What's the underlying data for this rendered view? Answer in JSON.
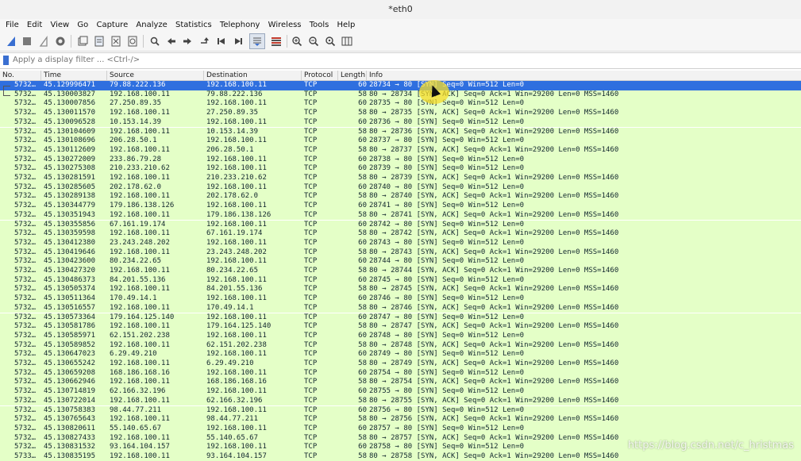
{
  "window": {
    "title": "*eth0"
  },
  "menu": [
    "File",
    "Edit",
    "View",
    "Go",
    "Capture",
    "Analyze",
    "Statistics",
    "Telephony",
    "Wireless",
    "Tools",
    "Help"
  ],
  "filter": {
    "placeholder": "Apply a display filter ... <Ctrl-/>"
  },
  "columns": {
    "no": "No.",
    "time": "Time",
    "source": "Source",
    "destination": "Destination",
    "protocol": "Protocol",
    "length": "Length",
    "info": "Info"
  },
  "packets": [
    {
      "no": "5732…",
      "time": "45.129996471",
      "src": "79.88.222.136",
      "dst": "192.168.100.11",
      "proto": "TCP",
      "len": "60",
      "info": "28734 → 80 [SYN] Seq=0 Win=512 Len=0",
      "selected": true
    },
    {
      "no": "5732…",
      "time": "45.130003827",
      "src": "192.168.100.11",
      "dst": "79.88.222.136",
      "proto": "TCP",
      "len": "58",
      "info": "80 → 28734 [SYN, ACK] Seq=0 Ack=1 Win=29200 Len=0 MSS=1460"
    },
    {
      "no": "5732…",
      "time": "45.130007856",
      "src": "27.250.89.35",
      "dst": "192.168.100.11",
      "proto": "TCP",
      "len": "60",
      "info": "28735 → 80 [SYN] Seq=0 Win=512 Len=0"
    },
    {
      "no": "5732…",
      "time": "45.130011570",
      "src": "192.168.100.11",
      "dst": "27.250.89.35",
      "proto": "TCP",
      "len": "58",
      "info": "80 → 28735 [SYN, ACK] Seq=0 Ack=1 Win=29200 Len=0 MSS=1460"
    },
    {
      "no": "5732…",
      "time": "45.130096528",
      "src": "10.153.14.39",
      "dst": "192.168.100.11",
      "proto": "TCP",
      "len": "60",
      "info": "28736 → 80 [SYN] Seq=0 Win=512 Len=0"
    },
    {
      "no": "5732…",
      "time": "45.130104609",
      "src": "192.168.100.11",
      "dst": "10.153.14.39",
      "proto": "TCP",
      "len": "58",
      "info": "80 → 28736 [SYN, ACK] Seq=0 Ack=1 Win=29200 Len=0 MSS=1460"
    },
    {
      "no": "5732…",
      "time": "45.130108696",
      "src": "206.28.50.1",
      "dst": "192.168.100.11",
      "proto": "TCP",
      "len": "60",
      "info": "28737 → 80 [SYN] Seq=0 Win=512 Len=0"
    },
    {
      "no": "5732…",
      "time": "45.130112609",
      "src": "192.168.100.11",
      "dst": "206.28.50.1",
      "proto": "TCP",
      "len": "58",
      "info": "80 → 28737 [SYN, ACK] Seq=0 Ack=1 Win=29200 Len=0 MSS=1460"
    },
    {
      "no": "5732…",
      "time": "45.130272009",
      "src": "233.86.79.28",
      "dst": "192.168.100.11",
      "proto": "TCP",
      "len": "60",
      "info": "28738 → 80 [SYN] Seq=0 Win=512 Len=0"
    },
    {
      "no": "5732…",
      "time": "45.130275308",
      "src": "210.233.210.62",
      "dst": "192.168.100.11",
      "proto": "TCP",
      "len": "60",
      "info": "28739 → 80 [SYN] Seq=0 Win=512 Len=0"
    },
    {
      "no": "5732…",
      "time": "45.130281591",
      "src": "192.168.100.11",
      "dst": "210.233.210.62",
      "proto": "TCP",
      "len": "58",
      "info": "80 → 28739 [SYN, ACK] Seq=0 Ack=1 Win=29200 Len=0 MSS=1460"
    },
    {
      "no": "5732…",
      "time": "45.130285605",
      "src": "202.178.62.0",
      "dst": "192.168.100.11",
      "proto": "TCP",
      "len": "60",
      "info": "28740 → 80 [SYN] Seq=0 Win=512 Len=0"
    },
    {
      "no": "5732…",
      "time": "45.130289138",
      "src": "192.168.100.11",
      "dst": "202.178.62.0",
      "proto": "TCP",
      "len": "58",
      "info": "80 → 28740 [SYN, ACK] Seq=0 Ack=1 Win=29200 Len=0 MSS=1460"
    },
    {
      "no": "5732…",
      "time": "45.130344779",
      "src": "179.186.138.126",
      "dst": "192.168.100.11",
      "proto": "TCP",
      "len": "60",
      "info": "28741 → 80 [SYN] Seq=0 Win=512 Len=0"
    },
    {
      "no": "5732…",
      "time": "45.130351943",
      "src": "192.168.100.11",
      "dst": "179.186.138.126",
      "proto": "TCP",
      "len": "58",
      "info": "80 → 28741 [SYN, ACK] Seq=0 Ack=1 Win=29200 Len=0 MSS=1460"
    },
    {
      "no": "5732…",
      "time": "45.130355856",
      "src": "67.161.19.174",
      "dst": "192.168.100.11",
      "proto": "TCP",
      "len": "60",
      "info": "28742 → 80 [SYN] Seq=0 Win=512 Len=0"
    },
    {
      "no": "5732…",
      "time": "45.130359598",
      "src": "192.168.100.11",
      "dst": "67.161.19.174",
      "proto": "TCP",
      "len": "58",
      "info": "80 → 28742 [SYN, ACK] Seq=0 Ack=1 Win=29200 Len=0 MSS=1460"
    },
    {
      "no": "5732…",
      "time": "45.130412380",
      "src": "23.243.248.202",
      "dst": "192.168.100.11",
      "proto": "TCP",
      "len": "60",
      "info": "28743 → 80 [SYN] Seq=0 Win=512 Len=0"
    },
    {
      "no": "5732…",
      "time": "45.130419646",
      "src": "192.168.100.11",
      "dst": "23.243.248.202",
      "proto": "TCP",
      "len": "58",
      "info": "80 → 28743 [SYN, ACK] Seq=0 Ack=1 Win=29200 Len=0 MSS=1460"
    },
    {
      "no": "5732…",
      "time": "45.130423600",
      "src": "80.234.22.65",
      "dst": "192.168.100.11",
      "proto": "TCP",
      "len": "60",
      "info": "28744 → 80 [SYN] Seq=0 Win=512 Len=0"
    },
    {
      "no": "5732…",
      "time": "45.130427320",
      "src": "192.168.100.11",
      "dst": "80.234.22.65",
      "proto": "TCP",
      "len": "58",
      "info": "80 → 28744 [SYN, ACK] Seq=0 Ack=1 Win=29200 Len=0 MSS=1460"
    },
    {
      "no": "5732…",
      "time": "45.130486373",
      "src": "84.201.55.136",
      "dst": "192.168.100.11",
      "proto": "TCP",
      "len": "60",
      "info": "28745 → 80 [SYN] Seq=0 Win=512 Len=0"
    },
    {
      "no": "5732…",
      "time": "45.130505374",
      "src": "192.168.100.11",
      "dst": "84.201.55.136",
      "proto": "TCP",
      "len": "58",
      "info": "80 → 28745 [SYN, ACK] Seq=0 Ack=1 Win=29200 Len=0 MSS=1460"
    },
    {
      "no": "5732…",
      "time": "45.130511364",
      "src": "170.49.14.1",
      "dst": "192.168.100.11",
      "proto": "TCP",
      "len": "60",
      "info": "28746 → 80 [SYN] Seq=0 Win=512 Len=0"
    },
    {
      "no": "5732…",
      "time": "45.130516557",
      "src": "192.168.100.11",
      "dst": "170.49.14.1",
      "proto": "TCP",
      "len": "58",
      "info": "80 → 28746 [SYN, ACK] Seq=0 Ack=1 Win=29200 Len=0 MSS=1460"
    },
    {
      "no": "5732…",
      "time": "45.130573364",
      "src": "179.164.125.140",
      "dst": "192.168.100.11",
      "proto": "TCP",
      "len": "60",
      "info": "28747 → 80 [SYN] Seq=0 Win=512 Len=0"
    },
    {
      "no": "5732…",
      "time": "45.130581786",
      "src": "192.168.100.11",
      "dst": "179.164.125.140",
      "proto": "TCP",
      "len": "58",
      "info": "80 → 28747 [SYN, ACK] Seq=0 Ack=1 Win=29200 Len=0 MSS=1460"
    },
    {
      "no": "5732…",
      "time": "45.130585971",
      "src": "62.151.202.238",
      "dst": "192.168.100.11",
      "proto": "TCP",
      "len": "60",
      "info": "28748 → 80 [SYN] Seq=0 Win=512 Len=0"
    },
    {
      "no": "5732…",
      "time": "45.130589852",
      "src": "192.168.100.11",
      "dst": "62.151.202.238",
      "proto": "TCP",
      "len": "58",
      "info": "80 → 28748 [SYN, ACK] Seq=0 Ack=1 Win=29200 Len=0 MSS=1460"
    },
    {
      "no": "5732…",
      "time": "45.130647023",
      "src": "6.29.49.210",
      "dst": "192.168.100.11",
      "proto": "TCP",
      "len": "60",
      "info": "28749 → 80 [SYN] Seq=0 Win=512 Len=0"
    },
    {
      "no": "5732…",
      "time": "45.130655242",
      "src": "192.168.100.11",
      "dst": "6.29.49.210",
      "proto": "TCP",
      "len": "58",
      "info": "80 → 28749 [SYN, ACK] Seq=0 Ack=1 Win=29200 Len=0 MSS=1460"
    },
    {
      "no": "5732…",
      "time": "45.130659208",
      "src": "168.186.168.16",
      "dst": "192.168.100.11",
      "proto": "TCP",
      "len": "60",
      "info": "28754 → 80 [SYN] Seq=0 Win=512 Len=0"
    },
    {
      "no": "5732…",
      "time": "45.130662946",
      "src": "192.168.100.11",
      "dst": "168.186.168.16",
      "proto": "TCP",
      "len": "58",
      "info": "80 → 28754 [SYN, ACK] Seq=0 Ack=1 Win=29200 Len=0 MSS=1460"
    },
    {
      "no": "5732…",
      "time": "45.130714819",
      "src": "62.166.32.196",
      "dst": "192.168.100.11",
      "proto": "TCP",
      "len": "60",
      "info": "28755 → 80 [SYN] Seq=0 Win=512 Len=0"
    },
    {
      "no": "5732…",
      "time": "45.130722014",
      "src": "192.168.100.11",
      "dst": "62.166.32.196",
      "proto": "TCP",
      "len": "58",
      "info": "80 → 28755 [SYN, ACK] Seq=0 Ack=1 Win=29200 Len=0 MSS=1460"
    },
    {
      "no": "5732…",
      "time": "45.130758383",
      "src": "98.44.77.211",
      "dst": "192.168.100.11",
      "proto": "TCP",
      "len": "60",
      "info": "28756 → 80 [SYN] Seq=0 Win=512 Len=0"
    },
    {
      "no": "5732…",
      "time": "45.130765643",
      "src": "192.168.100.11",
      "dst": "98.44.77.211",
      "proto": "TCP",
      "len": "58",
      "info": "80 → 28756 [SYN, ACK] Seq=0 Ack=1 Win=29200 Len=0 MSS=1460"
    },
    {
      "no": "5732…",
      "time": "45.130820611",
      "src": "55.140.65.67",
      "dst": "192.168.100.11",
      "proto": "TCP",
      "len": "60",
      "info": "28757 → 80 [SYN] Seq=0 Win=512 Len=0"
    },
    {
      "no": "5732…",
      "time": "45.130827433",
      "src": "192.168.100.11",
      "dst": "55.140.65.67",
      "proto": "TCP",
      "len": "58",
      "info": "80 → 28757 [SYN, ACK] Seq=0 Ack=1 Win=29200 Len=0 MSS=1460"
    },
    {
      "no": "5732…",
      "time": "45.130831532",
      "src": "93.164.104.157",
      "dst": "192.168.100.11",
      "proto": "TCP",
      "len": "60",
      "info": "28758 → 80 [SYN] Seq=0 Win=512 Len=0"
    },
    {
      "no": "5733…",
      "time": "45.130835195",
      "src": "192.168.100.11",
      "dst": "93.164.104.157",
      "proto": "TCP",
      "len": "58",
      "info": "80 → 28758 [SYN, ACK] Seq=0 Ack=1 Win=29200 Len=0 MSS=1460"
    }
  ],
  "watermark": "https://blog.csdn.net/c_hristmas",
  "colors": {
    "selected_row": "#2f6fdf",
    "tcp_row": "#e4ffc7"
  }
}
